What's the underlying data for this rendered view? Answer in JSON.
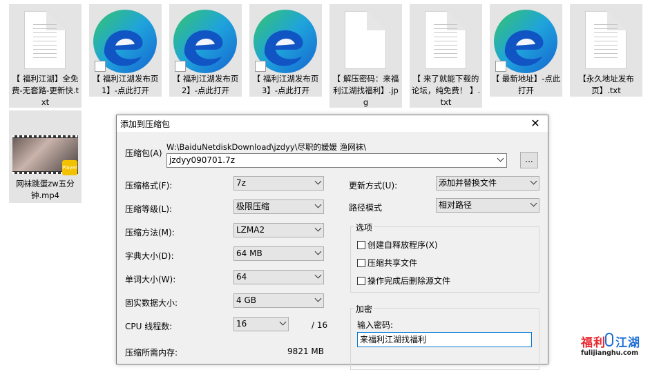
{
  "desktop": {
    "files": [
      {
        "type": "txt",
        "label": "【 福利江湖】全免费-无套路-更新快.txt"
      },
      {
        "type": "edge-shortcut",
        "label": "【 福利江湖发布页1】-点此打开"
      },
      {
        "type": "edge-shortcut",
        "label": "【 福利江湖发布页2】-点此打开"
      },
      {
        "type": "edge-shortcut",
        "label": "【 福利江湖发布页3】-点此打开"
      },
      {
        "type": "jpg",
        "label": "【 解压密码：来福利江湖找福利】.jpg"
      },
      {
        "type": "txt",
        "label": "【 来了就能下载的论坛，纯免费！ 】.txt"
      },
      {
        "type": "edge-shortcut",
        "label": "【 最新地址】-点此打开"
      },
      {
        "type": "txt",
        "label": "【永久地址发布页】.txt"
      }
    ],
    "video": {
      "label": "网袜跳蛋zw五分钟.mp4",
      "badge": "Player"
    }
  },
  "dialog": {
    "title": "添加到压缩包",
    "archive_label": "压缩包(A)",
    "archive_path": "W:\\BaiduNetdiskDownload\\jzdyy\\尽职的媛媛 渔网袜\\",
    "archive_name": "jzdyy090701.7z",
    "browse_label": "...",
    "format_label": "压缩格式(F):",
    "format_value": "7z",
    "level_label": "压缩等级(L):",
    "level_value": "极限压缩",
    "method_label": "压缩方法(M):",
    "method_value": "LZMA2",
    "dict_label": "字典大小(D):",
    "dict_value": "64 MB",
    "word_label": "单词大小(W):",
    "word_value": "64",
    "solid_label": "固实数据大小:",
    "solid_value": "4 GB",
    "cpu_label": "CPU 线程数:",
    "cpu_value": "16",
    "cpu_total": "/ 16",
    "mem_label": "压缩所需内存:",
    "mem_value": "9821 MB",
    "update_label": "更新方式(U):",
    "update_value": "添加并替换文件",
    "path_label": "路径模式",
    "path_value": "相对路径",
    "options_title": "选项",
    "opt_sfx": "创建自释放程序(X)",
    "opt_shared": "压缩共享文件",
    "opt_delete": "操作完成后删除源文件",
    "encrypt_title": "加密",
    "pwd_label": "输入密码:",
    "pwd_value": "来福利江湖找福利"
  },
  "watermark": {
    "cn_a": "福利",
    "cn_b": "江湖",
    "en": "fulijianghu.com"
  },
  "colors": {
    "accent": "#0078d7",
    "edge_blue": "#1769d1",
    "edge_green": "#34c26a",
    "wm_red": "#e8262c"
  }
}
